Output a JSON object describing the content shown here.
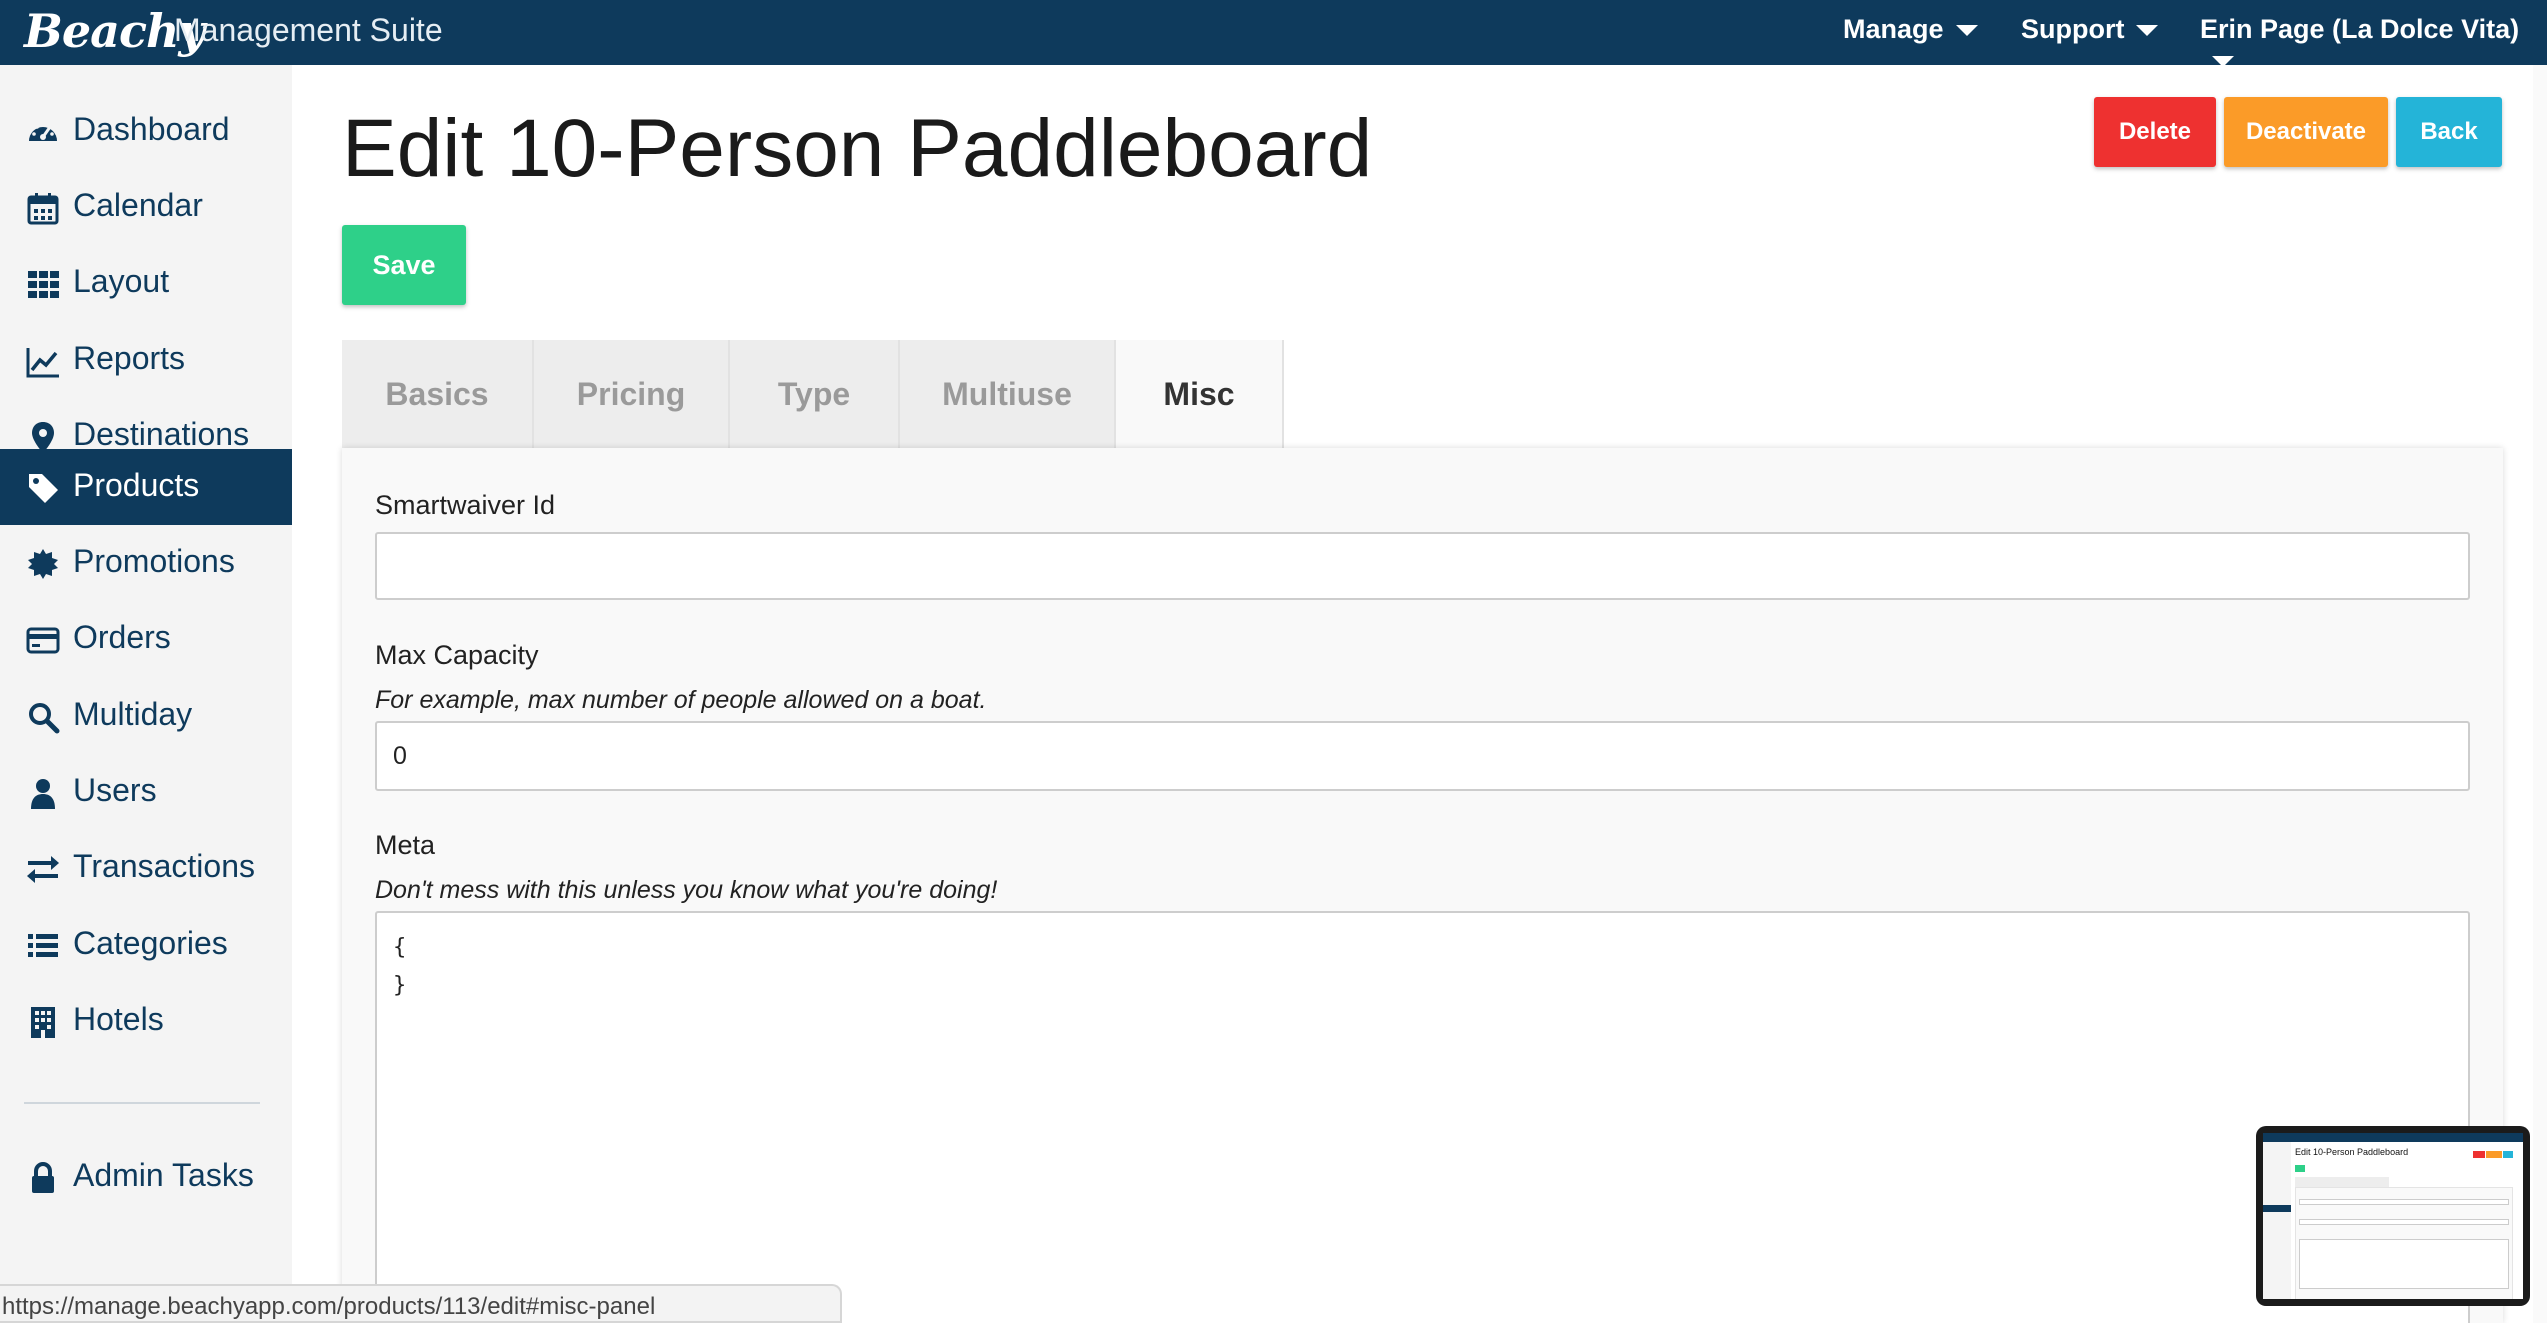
{
  "header": {
    "brand": "Beachy",
    "suite": "Management Suite",
    "menu": [
      "Manage",
      "Support",
      "Erin Page (La Dolce Vita)"
    ]
  },
  "sidebar": {
    "items": [
      {
        "label": "Dashboard",
        "icon": "dashboard-icon"
      },
      {
        "label": "Calendar",
        "icon": "calendar-icon"
      },
      {
        "label": "Layout",
        "icon": "grid-icon"
      },
      {
        "label": "Reports",
        "icon": "line-chart-icon"
      },
      {
        "label": "Destinations",
        "icon": "map-marker-icon"
      },
      {
        "label": "Products",
        "icon": "tag-icon",
        "active": true
      },
      {
        "label": "Promotions",
        "icon": "badge-icon"
      },
      {
        "label": "Orders",
        "icon": "credit-card-icon"
      },
      {
        "label": "Multiday",
        "icon": "search-icon"
      },
      {
        "label": "Users",
        "icon": "user-icon"
      },
      {
        "label": "Transactions",
        "icon": "exchange-icon"
      },
      {
        "label": "Categories",
        "icon": "list-icon"
      },
      {
        "label": "Hotels",
        "icon": "building-icon"
      }
    ],
    "admin": {
      "label": "Admin Tasks",
      "icon": "lock-icon"
    }
  },
  "page": {
    "title": "Edit 10-Person Paddleboard",
    "actions": {
      "delete": "Delete",
      "deactivate": "Deactivate",
      "back": "Back"
    },
    "save": "Save"
  },
  "tabs": [
    "Basics",
    "Pricing",
    "Type",
    "Multiuse",
    "Misc"
  ],
  "active_tab": "Misc",
  "form": {
    "smartwaiver": {
      "label": "Smartwaiver Id",
      "value": ""
    },
    "max_capacity": {
      "label": "Max Capacity",
      "hint": "For example, max number of people allowed on a boat.",
      "value": "0"
    },
    "meta": {
      "label": "Meta",
      "hint": "Don't mess with this unless you know what you're doing!",
      "value": "{\n}"
    }
  },
  "status_url": "https://manage.beachyapp.com/products/113/edit#misc-panel",
  "thumbnail": {
    "title": "Edit 10-Person Paddleboard"
  },
  "colors": {
    "navy": "#0e3a5c",
    "delete": "#ee3130",
    "deactivate": "#fb9b28",
    "back": "#24b4d8",
    "save": "#2ed089"
  }
}
